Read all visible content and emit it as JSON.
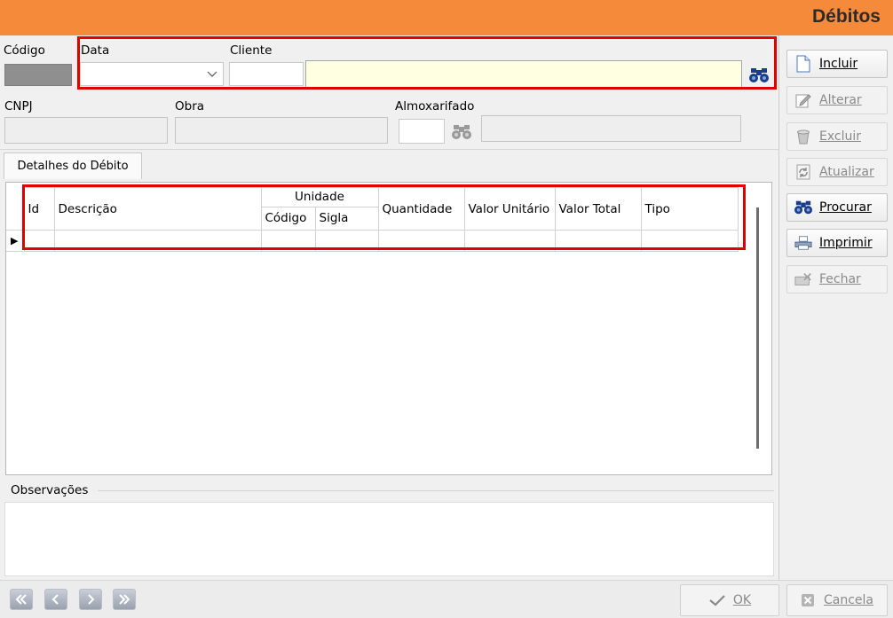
{
  "window": {
    "title": "Débitos"
  },
  "header": {
    "codigo_label": "Código",
    "data_label": "Data",
    "cliente_label": "Cliente",
    "cnpj_label": "CNPJ",
    "obra_label": "Obra",
    "almoxarifado_label": "Almoxarifado"
  },
  "tabs": [
    {
      "label": "Detalhes do Débito"
    }
  ],
  "grid": {
    "columns": {
      "id": "Id",
      "descricao": "Descrição",
      "unidade": "Unidade",
      "unidade_codigo": "Código",
      "unidade_sigla": "Sigla",
      "quantidade": "Quantidade",
      "valor_unitario": "Valor Unitário",
      "valor_total": "Valor Total",
      "tipo": "Tipo"
    },
    "row_indicator": "▶"
  },
  "observacoes": {
    "label": "Observações"
  },
  "sidebar": {
    "buttons": [
      {
        "label": "Incluir",
        "icon": "new-document-icon",
        "enabled": true
      },
      {
        "label": "Alterar",
        "icon": "edit-icon",
        "enabled": false
      },
      {
        "label": "Excluir",
        "icon": "delete-icon",
        "enabled": false
      },
      {
        "label": "Atualizar",
        "icon": "refresh-icon",
        "enabled": false
      },
      {
        "label": "Procurar",
        "icon": "binoculars-icon",
        "enabled": true
      },
      {
        "label": "Imprimir",
        "icon": "printer-icon",
        "enabled": true
      },
      {
        "label": "Fechar",
        "icon": "close-icon",
        "enabled": false
      }
    ]
  },
  "bottom": {
    "ok_label": "OK",
    "cancel_label": "Cancela",
    "nav": [
      "first-record-icon",
      "previous-record-icon",
      "next-record-icon",
      "last-record-icon"
    ]
  },
  "colors": {
    "title_bar": "#f58a3a",
    "cliente_field": "#ffffe1",
    "highlight": "#e00000"
  }
}
